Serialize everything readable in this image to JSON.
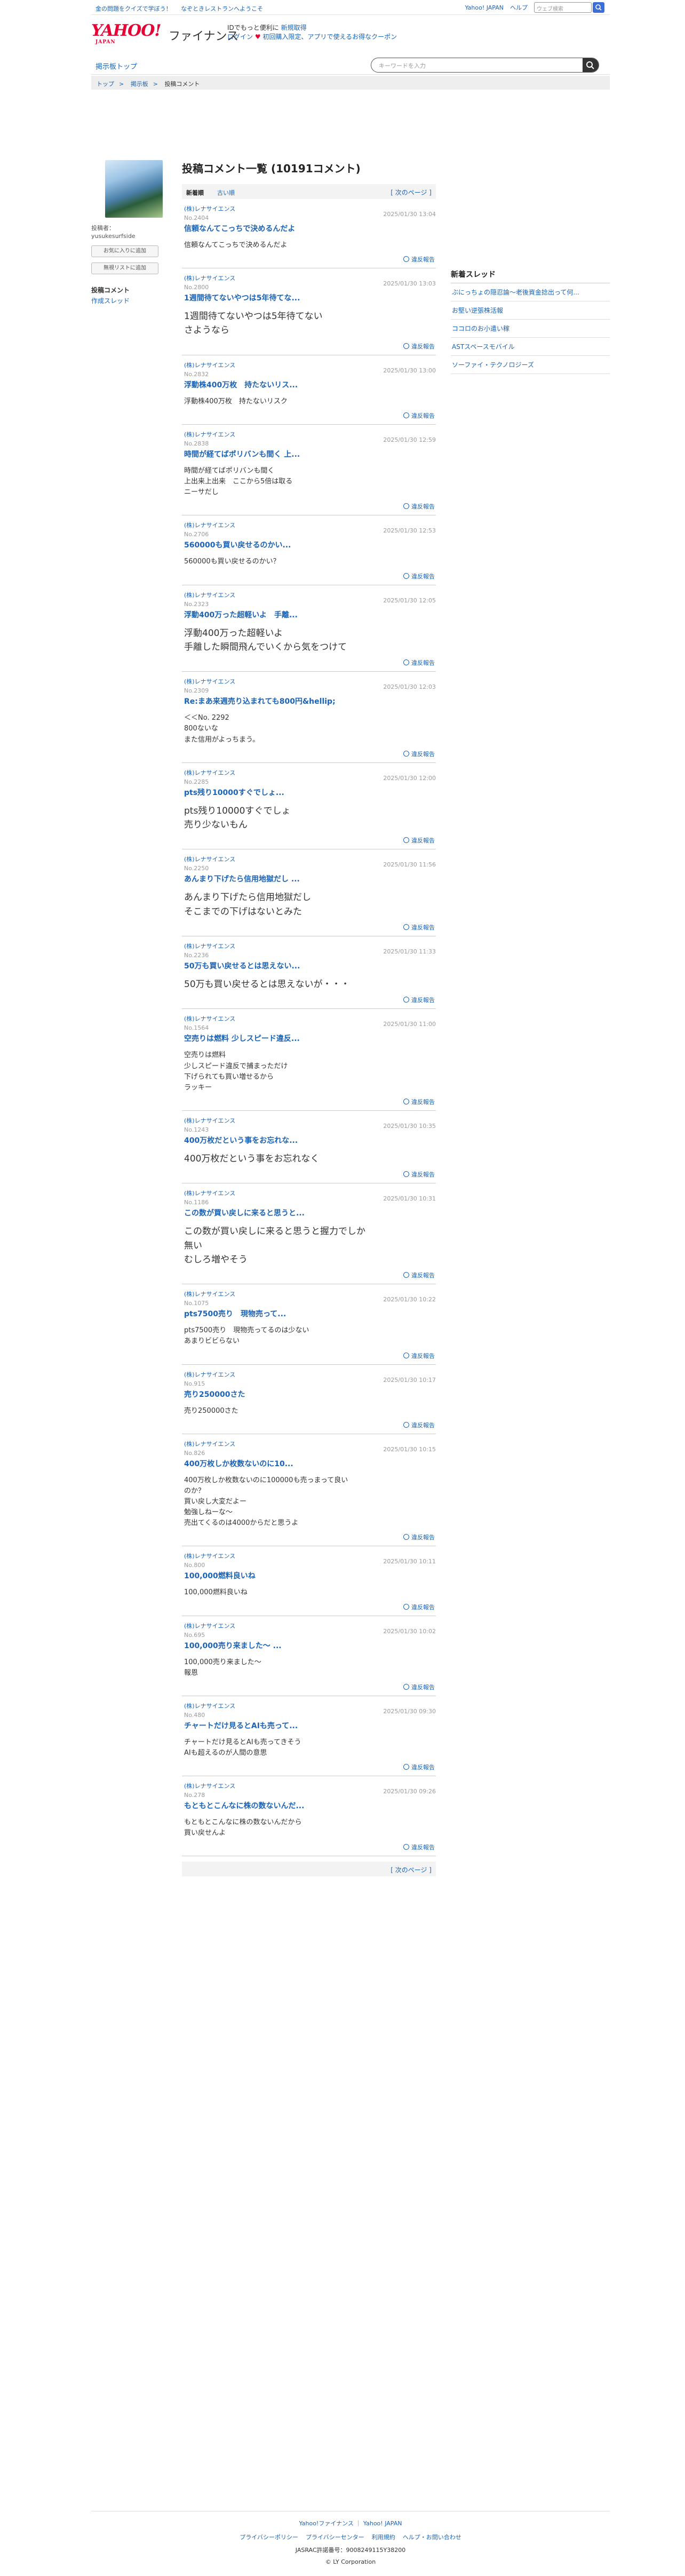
{
  "topbar": {
    "links": [
      "金の問題をクイズで学ぼう！",
      "なぞときレストランへようこそ"
    ],
    "right_links": [
      "Yahoo! JAPAN",
      "ヘルプ"
    ],
    "search_placeholder": "ウェブ検索"
  },
  "header": {
    "logo": "YAHOO!",
    "logo_small": "JAPAN",
    "service": "ファイナンス",
    "promo_line1": "IDでもっと便利に",
    "promo_new": "新規取得",
    "promo_line2": "ログイン",
    "promo_coupon": "初回購入限定、アプリで使えるお得なクーポン"
  },
  "nav": {
    "board_top": "掲示板トップ",
    "search_placeholder": "キーワードを入力"
  },
  "breadcrumb": [
    "トップ",
    "掲示板",
    "投稿コメント"
  ],
  "user": {
    "label": "投稿者：",
    "name": "yusukesurfside",
    "btn_follow": "お気に入りに追加",
    "btn_block": "無視リストに追加",
    "nav": [
      "投稿コメント",
      "作成スレッド"
    ]
  },
  "main": {
    "title": "投稿コメント一覧 (10191コメント)",
    "tab_new": "新着順",
    "tab_old": "古い順",
    "next": "[ 次のページ ]",
    "report": "違反報告",
    "posts": [
      {
        "thread": "(株)レナサイエンス",
        "no": "No.2404",
        "date": "2025/01/30 13:04",
        "title": "信頼なんてこっちで決めるんだよ",
        "body": "信頼なんてこっちで決めるんだよ",
        "big": false
      },
      {
        "thread": "(株)レナサイエンス",
        "no": "No.2800",
        "date": "2025/01/30 13:03",
        "title": "1週間待てないやつは5年待てな...",
        "body": "1週間待てないやつは5年待てない\nさようなら",
        "big": true
      },
      {
        "thread": "(株)レナサイエンス",
        "no": "No.2832",
        "date": "2025/01/30 13:00",
        "title": "浮動株400万枚　持たないリス...",
        "body": "浮動株400万枚　持たないリスク",
        "big": false
      },
      {
        "thread": "(株)レナサイエンス",
        "no": "No.2838",
        "date": "2025/01/30 12:59",
        "title": "時間が経てばポリバンも間く 上...",
        "body": "時間が経てばポリバンも間く\n上出来上出来　ここから5倍は取る\nニーサだし",
        "big": false
      },
      {
        "thread": "(株)レナサイエンス",
        "no": "No.2706",
        "date": "2025/01/30 12:53",
        "title": "560000も買い戻せるのかい...",
        "body": "560000も買い戻せるのかい？",
        "big": false
      },
      {
        "thread": "(株)レナサイエンス",
        "no": "No.2323",
        "date": "2025/01/30 12:05",
        "title": "浮動400万った超軽いよ　手離...",
        "body": "浮動400万った超軽いよ\n手離した瞬間飛んでいくから気をつけて",
        "big": true
      },
      {
        "thread": "(株)レナサイエンス",
        "no": "No.2309",
        "date": "2025/01/30 12:03",
        "title": "Re:まあ来週売り込まれても800円&hellip;",
        "body": "＜＜No. 2292\n800ないな\nまた信用がよっちまう。",
        "big": false
      },
      {
        "thread": "(株)レナサイエンス",
        "no": "No.2285",
        "date": "2025/01/30 12:00",
        "title": "pts残り10000すぐでしょ...",
        "body": "pts残り10000すぐでしょ\n売り少ないもん",
        "big": true
      },
      {
        "thread": "(株)レナサイエンス",
        "no": "No.2250",
        "date": "2025/01/30 11:56",
        "title": "あんまり下げたら信用地獄だし ...",
        "body": "あんまり下げたら信用地獄だし\nそこまでの下げはないとみた",
        "big": true
      },
      {
        "thread": "(株)レナサイエンス",
        "no": "No.2236",
        "date": "2025/01/30 11:33",
        "title": "50万も買い戻せるとは思えない...",
        "body": "50万も買い戻せるとは思えないが・・・",
        "big": true
      },
      {
        "thread": "(株)レナサイエンス",
        "no": "No.1564",
        "date": "2025/01/30 11:00",
        "title": "空売りは燃料 少しスピード違反...",
        "body": "空売りは燃料\n少しスピード違反で捕まっただけ\n下げられても買い増せるから\nラッキー",
        "big": false
      },
      {
        "thread": "(株)レナサイエンス",
        "no": "No.1243",
        "date": "2025/01/30 10:35",
        "title": "400万枚だという事をお忘れな...",
        "body": "400万枚だという事をお忘れなく",
        "big": true
      },
      {
        "thread": "(株)レナサイエンス",
        "no": "No.1186",
        "date": "2025/01/30 10:31",
        "title": "この数が買い戻しに来ると思うと...",
        "body": "この数が買い戻しに来ると思うと握力でしか\n無い\nむしろ増やそう",
        "big": true
      },
      {
        "thread": "(株)レナサイエンス",
        "no": "No.1075",
        "date": "2025/01/30 10:22",
        "title": "pts7500売り　現物売って...",
        "body": "pts7500売り　現物売ってるのは少ない\nあまりビビらない",
        "big": false
      },
      {
        "thread": "(株)レナサイエンス",
        "no": "No.915",
        "date": "2025/01/30 10:17",
        "title": "売り250000さた",
        "body": "売り250000さた",
        "big": false
      },
      {
        "thread": "(株)レナサイエンス",
        "no": "No.826",
        "date": "2025/01/30 10:15",
        "title": "400万枚しか枚数ないのに10...",
        "body": "400万枚しか枚数ないのに100000も売っまって良い\nのか？\n買い戻し大変だよー\n勉強しねーな〜\n売出てくるのは4000からだと思うよ",
        "big": false
      },
      {
        "thread": "(株)レナサイエンス",
        "no": "No.800",
        "date": "2025/01/30 10:11",
        "title": "100,000燃料良いね",
        "body": "100,000燃料良いね",
        "big": false
      },
      {
        "thread": "(株)レナサイエンス",
        "no": "No.695",
        "date": "2025/01/30 10:02",
        "title": "100,000売り来ました〜 ...",
        "body": "100,000売り来ました〜\n報恩",
        "big": false
      },
      {
        "thread": "(株)レナサイエンス",
        "no": "No.480",
        "date": "2025/01/30 09:30",
        "title": "チャートだけ見るとAIも売って...",
        "body": "チャートだけ見るとAIも売ってきそう\nAIも超えるのが人間の意思",
        "big": false
      },
      {
        "thread": "(株)レナサイエンス",
        "no": "No.278",
        "date": "2025/01/30 09:26",
        "title": "もともとこんなに株の数ないんだ...",
        "body": "もともとこんなに株の数ないんだから\n買い戻せんよ",
        "big": false
      }
    ]
  },
  "sidebar": {
    "title": "新着スレッド",
    "threads": [
      "ぶにっちょの隠忍論〜老後資金捻出って何...",
      "お堅い逆張株活報",
      "ココロのお小遣い稼",
      "ASTスペースモバイル",
      "ソーファイ・テクノロジーズ"
    ]
  },
  "footer": {
    "row1": [
      "Yahoo!ファイナンス",
      "Yahoo! JAPAN"
    ],
    "row2": [
      "プライバシーポリシー",
      "プライバシーセンター",
      "利用規約",
      "ヘルプ・お問い合わせ"
    ],
    "row3": "JASRAC許諾番号：9008249115Y38200",
    "row4": "© LY Corporation"
  }
}
